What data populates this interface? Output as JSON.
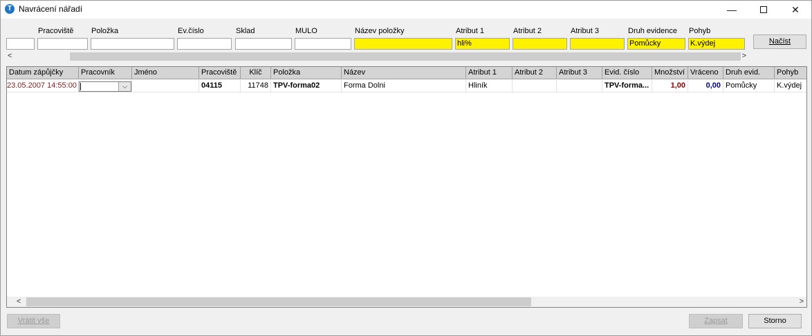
{
  "window": {
    "title": "Navrácení nářadí",
    "app_icon_glyph": "T",
    "minimize": "—",
    "close": "✕"
  },
  "filters": {
    "labels": {
      "pracoviste": "Pracoviště",
      "polozka": "Položka",
      "evcislo": "Ev.číslo",
      "sklad": "Sklad",
      "mulo": "MULO",
      "nazev": "Název položky",
      "atribut1": "Atribut 1",
      "atribut2": "Atribut 2",
      "atribut3": "Atribut 3",
      "druh": "Druh evidence",
      "pohyb": "Pohyb"
    },
    "values": {
      "first": "",
      "pracoviste": "",
      "polozka": "",
      "evcislo": "",
      "sklad": "",
      "mulo": "",
      "nazev": "",
      "atribut1": "hli%",
      "atribut2": "",
      "atribut3": "",
      "druh": "Pomůcky",
      "pohyb": "K.výdej"
    },
    "load_button": "Načíst",
    "highlight_color": "#fff200"
  },
  "grid": {
    "columns": [
      "Datum zápůjčky",
      "Pracovník",
      "Jméno",
      "Pracoviště",
      "Klíč",
      "Položka",
      "Název",
      "Atribut 1",
      "Atribut 2",
      "Atribut 3",
      "Evid. číslo",
      "Množství",
      "Vráceno",
      "Druh evid.",
      "Pohyb"
    ],
    "row": {
      "datum": "23.05.2007 14:55:00",
      "pracovnik": "",
      "jmeno": "",
      "pracoviste": "04115",
      "klic": "11748",
      "polozka": "TPV-forma02",
      "nazev": "Forma Dolni",
      "atribut1": "Hliník",
      "atribut2": "",
      "atribut3": "",
      "evid": "TPV-forma...",
      "mnozstvi": "1,00",
      "vraceno": "0,00",
      "druh": "Pomůcky",
      "pohyb": "K.výdej"
    },
    "colors": {
      "date": "#8b1a1a",
      "mnozstvi": "#8b0000",
      "vraceno": "#00007f"
    }
  },
  "buttons": {
    "return_all": "Vrátit vše",
    "save": "Zapsat",
    "cancel": "Storno"
  },
  "scroll": {
    "left_arrow": "<",
    "right_arrow": ">"
  }
}
